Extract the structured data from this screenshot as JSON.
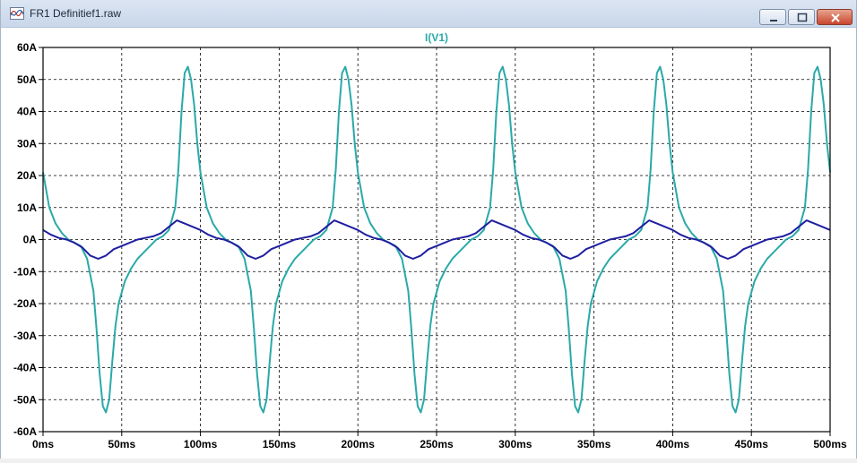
{
  "window": {
    "title": "FR1 Definitief1.raw",
    "app_icon": "waveform-viewer-icon",
    "controls": [
      "minimize-icon",
      "maximize-icon",
      "close-icon"
    ]
  },
  "chart_data": {
    "type": "line",
    "title": "I(V1)",
    "title_color": "#2aa9a9",
    "xlabel": "",
    "ylabel": "",
    "xlim": [
      0,
      500
    ],
    "ylim": [
      -60,
      60
    ],
    "grid": true,
    "x_ticks": [
      "0ms",
      "50ms",
      "100ms",
      "150ms",
      "200ms",
      "250ms",
      "300ms",
      "350ms",
      "400ms",
      "450ms",
      "500ms"
    ],
    "y_ticks": [
      "60A",
      "50A",
      "40A",
      "30A",
      "20A",
      "10A",
      "0A",
      "-10A",
      "-20A",
      "-30A",
      "-40A",
      "-50A",
      "-60A"
    ],
    "x_unit": "ms",
    "y_unit": "A",
    "series": [
      {
        "color": "#2aa9a9",
        "period": 100,
        "x": [
          0,
          4,
          8,
          12,
          16,
          20,
          24,
          28,
          32,
          34,
          36,
          38,
          40,
          42,
          44,
          46,
          48,
          52,
          56,
          60,
          64,
          68,
          72,
          76,
          80,
          84,
          86,
          88,
          90,
          92,
          94,
          96,
          98,
          100
        ],
        "y": [
          21,
          10,
          5,
          2,
          0,
          -1,
          -2,
          -6,
          -16,
          -28,
          -42,
          -52,
          -54,
          -50,
          -38,
          -27,
          -20,
          -13,
          -9,
          -6,
          -4,
          -2,
          0,
          1,
          3,
          10,
          22,
          40,
          52,
          54,
          50,
          42,
          30,
          21
        ]
      },
      {
        "color": "#1f1fa0",
        "period": 100,
        "x": [
          0,
          5,
          10,
          15,
          20,
          25,
          30,
          35,
          40,
          45,
          50,
          55,
          60,
          65,
          70,
          75,
          80,
          85,
          90,
          95,
          100
        ],
        "y": [
          3,
          1.5,
          0.5,
          0,
          -1,
          -2.5,
          -5,
          -6,
          -5,
          -3,
          -2,
          -1,
          0,
          0.5,
          1,
          2,
          4,
          6,
          5,
          4,
          3
        ]
      }
    ]
  }
}
